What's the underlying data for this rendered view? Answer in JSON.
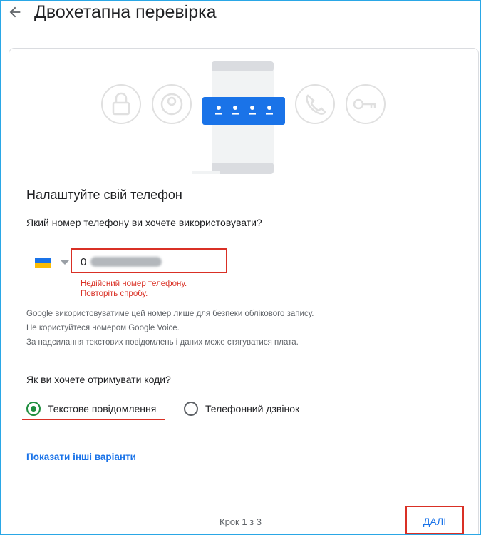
{
  "header": {
    "title": "Двохетапна перевірка",
    "back_icon": "arrow-left-icon"
  },
  "illustration": {
    "icons": [
      "lock-icon",
      "account-circle-icon",
      "phone-icon",
      "key-icon"
    ],
    "code_mask": "password-dots"
  },
  "setup": {
    "heading": "Налаштуйте свій телефон",
    "phone_question": "Який номер телефону ви хочете використовувати?",
    "country_flag": "UA",
    "phone_value": "0",
    "error_line1": "Недійсний номер телефону.",
    "error_line2": "Повторіть спробу.",
    "note1": "Google використовуватиме цей номер лише для безпеки облікового запису.",
    "note2": "Не користуйтеся номером Google Voice.",
    "note3": "За надсилання текстових повідомлень і даних може стягуватися плата."
  },
  "delivery": {
    "question": "Як ви хочете отримувати коди?",
    "options": [
      {
        "label": "Текстове повідомлення",
        "selected": true
      },
      {
        "label": "Телефонний дзвінок",
        "selected": false
      }
    ]
  },
  "more_options_label": "Показати інші варіанти",
  "footer": {
    "step": "Крок 1 з 3",
    "next_label": "ДАЛІ"
  },
  "colors": {
    "accent": "#1a73e8",
    "error": "#d93025",
    "radio_selected": "#1e8e3e",
    "frame": "#2aa7e6"
  }
}
